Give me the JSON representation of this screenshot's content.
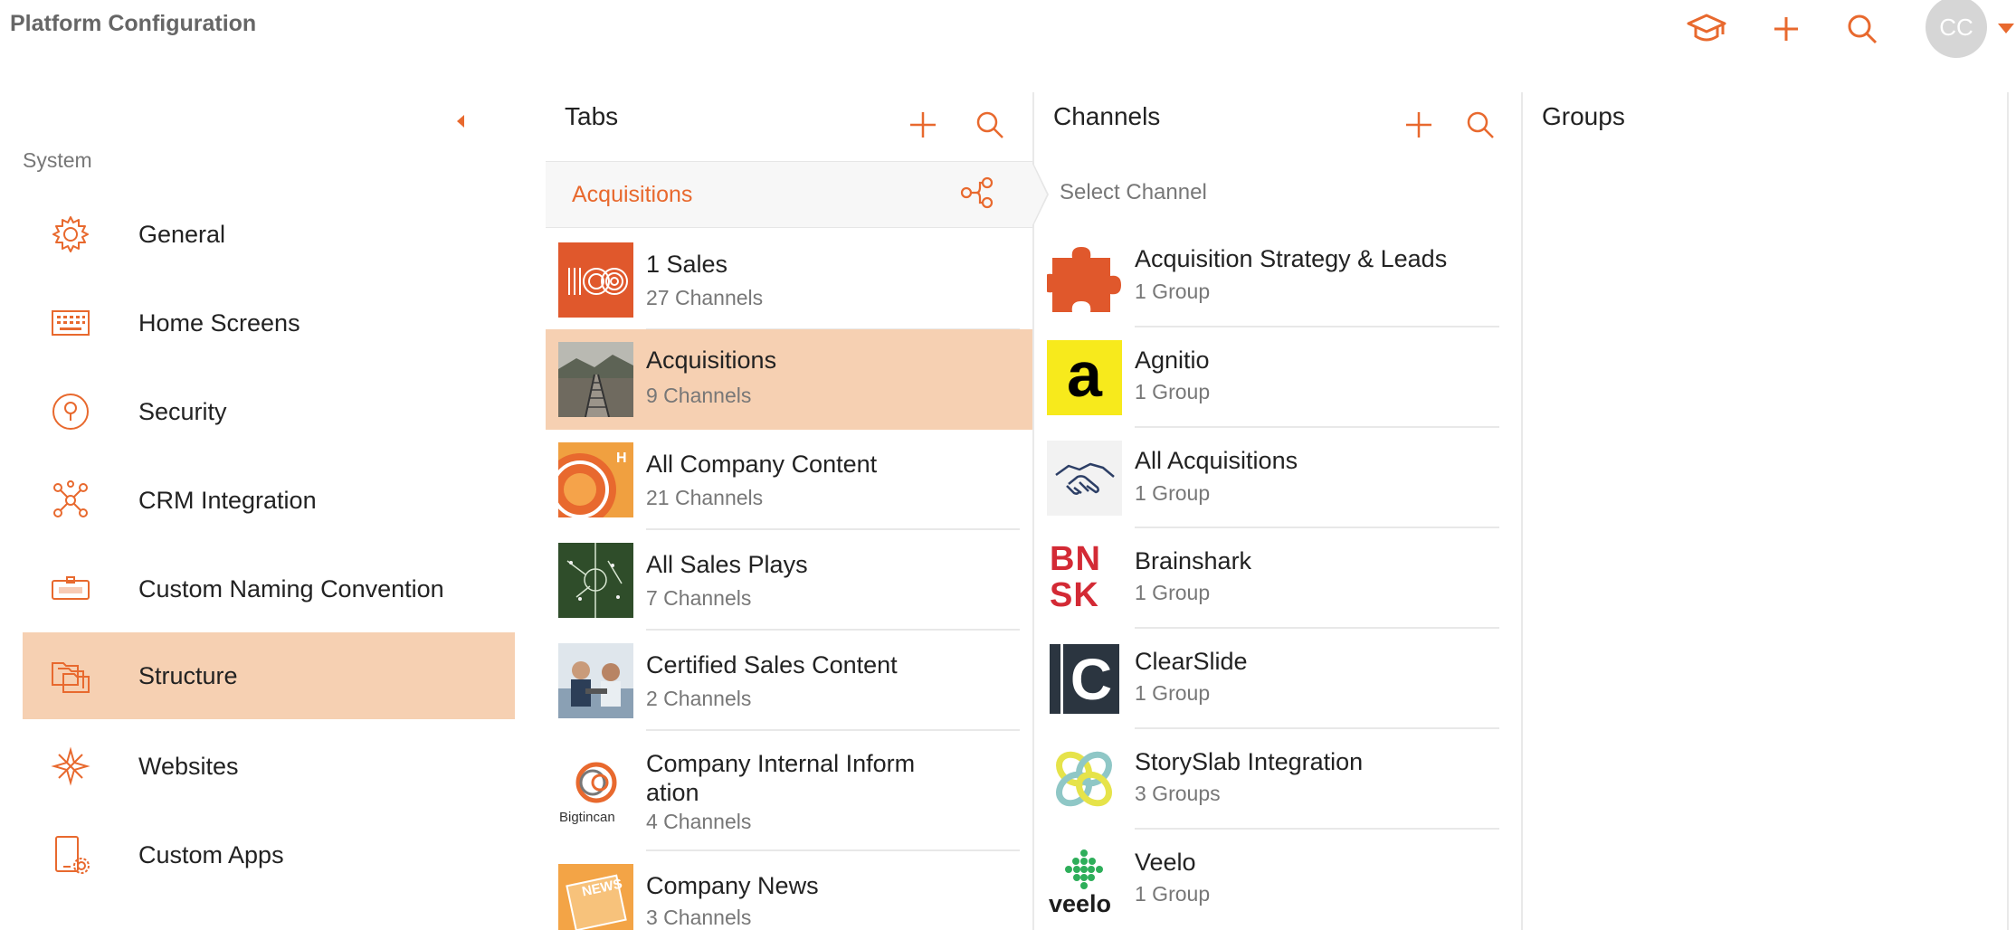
{
  "header": {
    "title": "Platform Configuration",
    "icons": [
      "graduation-cap-icon",
      "plus-icon",
      "search-icon"
    ],
    "avatar_initials": "CC",
    "accent_color": "#e8692e"
  },
  "sidebar": {
    "section_label": "System",
    "items": [
      {
        "label": "General",
        "icon": "gear-icon"
      },
      {
        "label": "Home Screens",
        "icon": "keyboard-icon"
      },
      {
        "label": "Security",
        "icon": "lock-circle-icon"
      },
      {
        "label": "CRM Integration",
        "icon": "network-icon"
      },
      {
        "label": "Custom Naming Convention",
        "icon": "name-tag-icon"
      },
      {
        "label": "Structure",
        "icon": "folders-icon",
        "active": true
      },
      {
        "label": "Websites",
        "icon": "compass-icon"
      },
      {
        "label": "Custom Apps",
        "icon": "tablet-gear-icon"
      }
    ]
  },
  "tabs": {
    "title": "Tabs",
    "selected": "Acquisitions",
    "items": [
      {
        "name": "1 Sales",
        "count": "27 Channels"
      },
      {
        "name": "Acquisitions",
        "count": "9 Channels",
        "active": true
      },
      {
        "name": "All Company Content",
        "count": "21 Channels"
      },
      {
        "name": "All Sales Plays",
        "count": "7 Channels"
      },
      {
        "name": "Certified Sales Content",
        "count": "2 Channels"
      },
      {
        "name": "Company Internal Inform ation",
        "count": "4 Channels",
        "thumb_text": "Bigtincan"
      },
      {
        "name": "Company News",
        "count": "3 Channels",
        "thumb_text": "NEWS"
      }
    ]
  },
  "channels": {
    "title": "Channels",
    "placeholder": "Select Channel",
    "items": [
      {
        "name": "Acquisition Strategy & Leads",
        "count": "1 Group"
      },
      {
        "name": "Agnitio",
        "count": "1 Group",
        "thumb_text": "a"
      },
      {
        "name": "All Acquisitions",
        "count": "1 Group"
      },
      {
        "name": "Brainshark",
        "count": "1 Group",
        "thumb_text": "BNSK"
      },
      {
        "name": "ClearSlide",
        "count": "1 Group",
        "thumb_text": "C"
      },
      {
        "name": "StorySlab Integration",
        "count": "3 Groups"
      },
      {
        "name": "Veelo",
        "count": "1 Group",
        "thumb_text": "veelo"
      }
    ]
  },
  "groups": {
    "title": "Groups"
  }
}
